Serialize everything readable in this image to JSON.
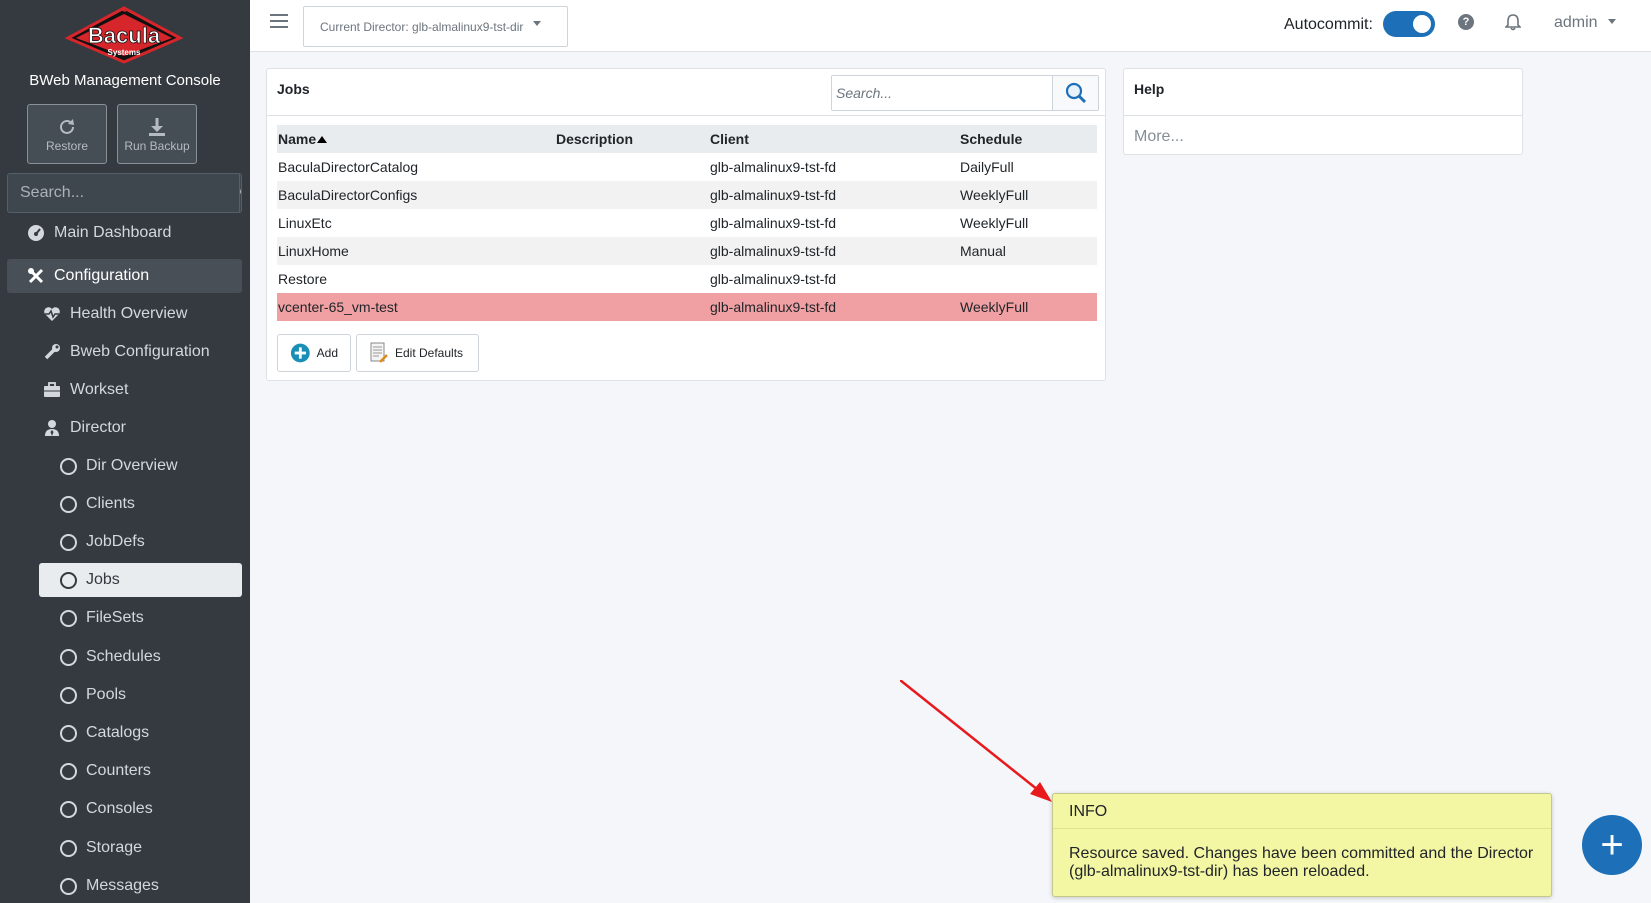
{
  "sidebar": {
    "logo_text": "Bacula",
    "logo_subtext": "Systems",
    "console_title": "BWeb Management Console",
    "restore_label": "Restore",
    "run_backup_label": "Run Backup",
    "search_placeholder": "Search...",
    "nav": {
      "main_dashboard": "Main Dashboard",
      "configuration": "Configuration",
      "health_overview": "Health Overview",
      "bweb_configuration": "Bweb Configuration",
      "workset": "Workset",
      "director": "Director",
      "dir_overview": "Dir Overview",
      "clients": "Clients",
      "jobdefs": "JobDefs",
      "jobs": "Jobs",
      "filesets": "FileSets",
      "schedules": "Schedules",
      "pools": "Pools",
      "catalogs": "Catalogs",
      "counters": "Counters",
      "consoles": "Consoles",
      "storage": "Storage",
      "messages": "Messages"
    }
  },
  "topbar": {
    "director_select": "Current Director: glb-almalinux9-tst-dir",
    "autocommit_label": "Autocommit:",
    "autocommit_on": true,
    "user": "admin"
  },
  "jobs_card": {
    "title": "Jobs",
    "search_placeholder": "Search...",
    "columns": [
      "Name",
      "Description",
      "Client",
      "Schedule"
    ],
    "rows": [
      {
        "name": "BaculaDirectorCatalog",
        "description": "",
        "client": "glb-almalinux9-tst-fd",
        "schedule": "DailyFull"
      },
      {
        "name": "BaculaDirectorConfigs",
        "description": "",
        "client": "glb-almalinux9-tst-fd",
        "schedule": "WeeklyFull"
      },
      {
        "name": "LinuxEtc",
        "description": "",
        "client": "glb-almalinux9-tst-fd",
        "schedule": "WeeklyFull"
      },
      {
        "name": "LinuxHome",
        "description": "",
        "client": "glb-almalinux9-tst-fd",
        "schedule": "Manual"
      },
      {
        "name": "Restore",
        "description": "",
        "client": "glb-almalinux9-tst-fd",
        "schedule": ""
      },
      {
        "name": "vcenter-65_vm-test",
        "description": "",
        "client": "glb-almalinux9-tst-fd",
        "schedule": "WeeklyFull"
      }
    ],
    "add_label": "Add",
    "edit_defaults_label": "Edit Defaults"
  },
  "help_card": {
    "title": "Help",
    "more_label": "More..."
  },
  "toast": {
    "title": "INFO",
    "message": "Resource saved. Changes have been committed and the Director (glb-almalinux9-tst-dir) has been reloaded."
  },
  "fab_label": "+",
  "colors": {
    "sidebar_bg": "#343a40",
    "accent": "#1d70b7",
    "highlight_row": "#f0a0a3",
    "toast_bg": "#f3f6a3",
    "arrow": "#e8191c"
  }
}
